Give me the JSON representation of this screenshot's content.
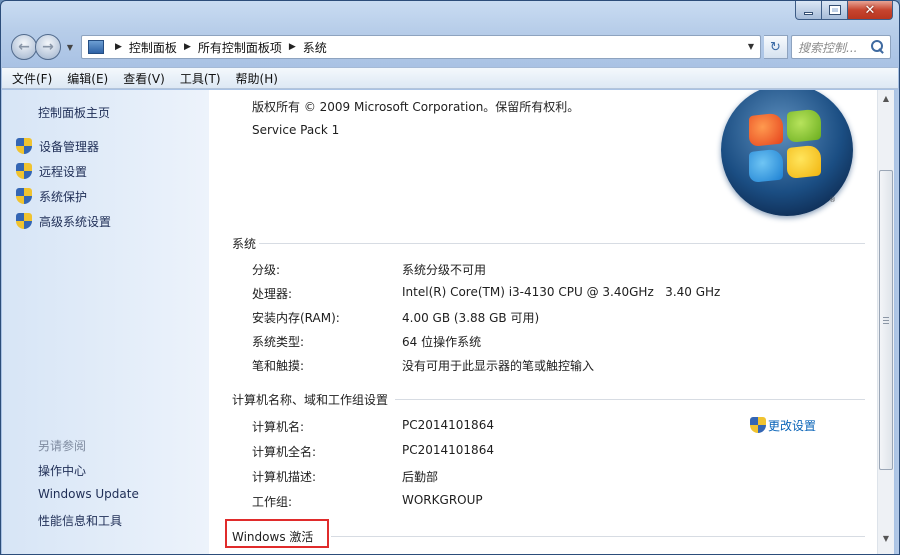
{
  "navigation": {
    "breadcrumb": [
      "控制面板",
      "所有控制面板项",
      "系统"
    ],
    "search_placeholder": "搜索控制..."
  },
  "menu": [
    "文件(F)",
    "编辑(E)",
    "查看(V)",
    "工具(T)",
    "帮助(H)"
  ],
  "sidebar": {
    "home": "控制面板主页",
    "tasks": [
      "设备管理器",
      "远程设置",
      "系统保护",
      "高级系统设置"
    ],
    "see_also_title": "另请参阅",
    "see_also": [
      "操作中心",
      "Windows Update",
      "性能信息和工具"
    ]
  },
  "main": {
    "copyright": "版权所有 © 2009 Microsoft Corporation。保留所有权利。",
    "service_pack": "Service Pack 1",
    "system_section": {
      "title": "系统",
      "rows": [
        {
          "label": "分级:",
          "value": "系统分级不可用"
        },
        {
          "label": "处理器:",
          "value": "Intel(R) Core(TM) i3-4130 CPU @ 3.40GHz   3.40 GHz"
        },
        {
          "label": "安装内存(RAM):",
          "value": "4.00 GB (3.88 GB 可用)"
        },
        {
          "label": "系统类型:",
          "value": "64 位操作系统"
        },
        {
          "label": "笔和触摸:",
          "value": "没有可用于此显示器的笔或触控输入"
        }
      ]
    },
    "computer_section": {
      "title": "计算机名称、域和工作组设置",
      "change_settings": "更改设置",
      "rows": [
        {
          "label": "计算机名:",
          "value": "PC2014101864"
        },
        {
          "label": "计算机全名:",
          "value": "PC2014101864"
        },
        {
          "label": "计算机描述:",
          "value": "后勤部"
        },
        {
          "label": "工作组:",
          "value": "WORKGROUP"
        }
      ]
    },
    "activation_section": {
      "title": "Windows 激活"
    }
  },
  "colors": {
    "link": "#0a64b8",
    "highlight_box": "#e02b2b"
  }
}
